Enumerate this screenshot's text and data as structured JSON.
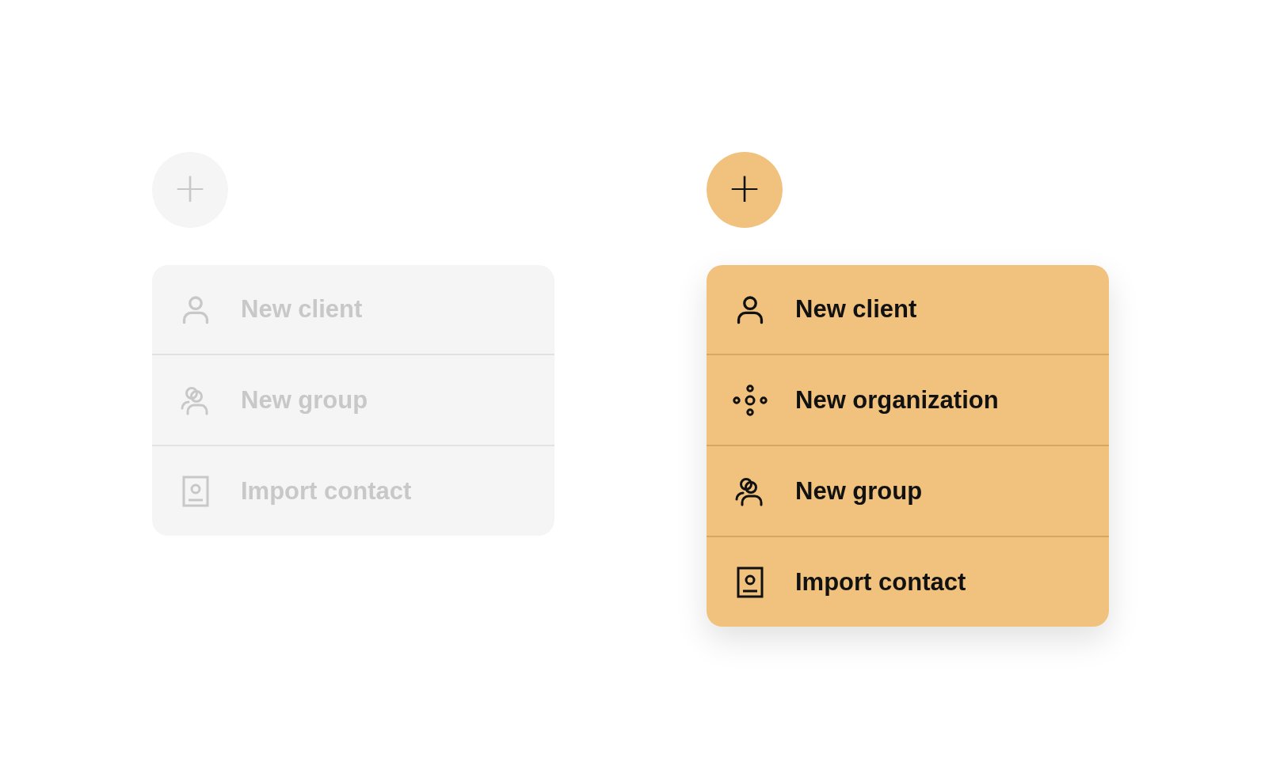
{
  "menus": [
    {
      "disabled": true,
      "add_button": {
        "label": "+"
      },
      "items": [
        {
          "kind": "person",
          "label": "New client"
        },
        {
          "kind": "group",
          "label": "New group"
        },
        {
          "kind": "contact",
          "label": "Import contact"
        }
      ]
    },
    {
      "disabled": false,
      "add_button": {
        "label": "+"
      },
      "items": [
        {
          "kind": "person",
          "label": "New client"
        },
        {
          "kind": "organization",
          "label": "New organization"
        },
        {
          "kind": "group",
          "label": "New group"
        },
        {
          "kind": "contact",
          "label": "Import contact"
        }
      ]
    }
  ]
}
